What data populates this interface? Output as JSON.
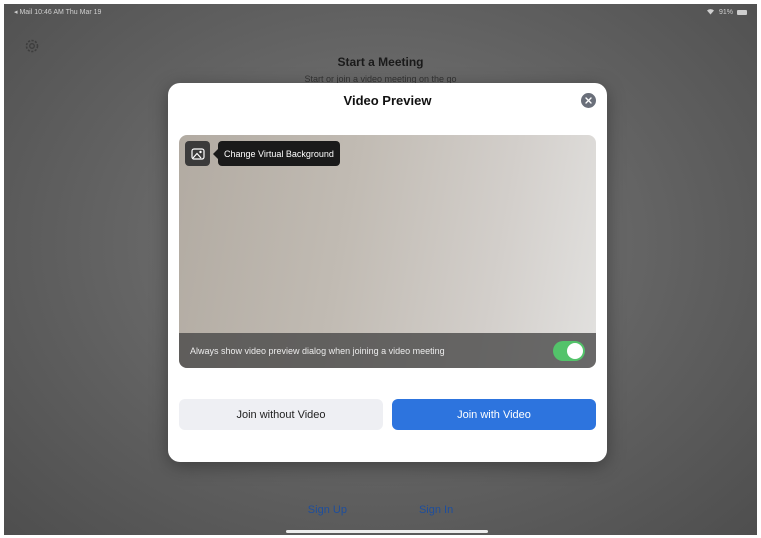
{
  "statusbar": {
    "left": "◂ Mail  10:46 AM  Thu Mar 19",
    "right": "91%"
  },
  "background": {
    "title": "Start a Meeting",
    "subtitle": "Start or join a video meeting on the go",
    "sign_up": "Sign Up",
    "sign_in": "Sign In"
  },
  "modal": {
    "title": "Video Preview",
    "tooltip": "Change Virtual Background",
    "always_show": "Always show video preview dialog when joining a video meeting",
    "toggle_on": true,
    "join_without_video": "Join without Video",
    "join_with_video": "Join with Video"
  },
  "colors": {
    "primary": "#2d74de",
    "toggle": "#53c36a",
    "link": "#1e4e9c"
  },
  "icons": [
    "gear-icon",
    "close-icon",
    "virtual-background-icon",
    "wifi-icon",
    "battery-icon"
  ]
}
